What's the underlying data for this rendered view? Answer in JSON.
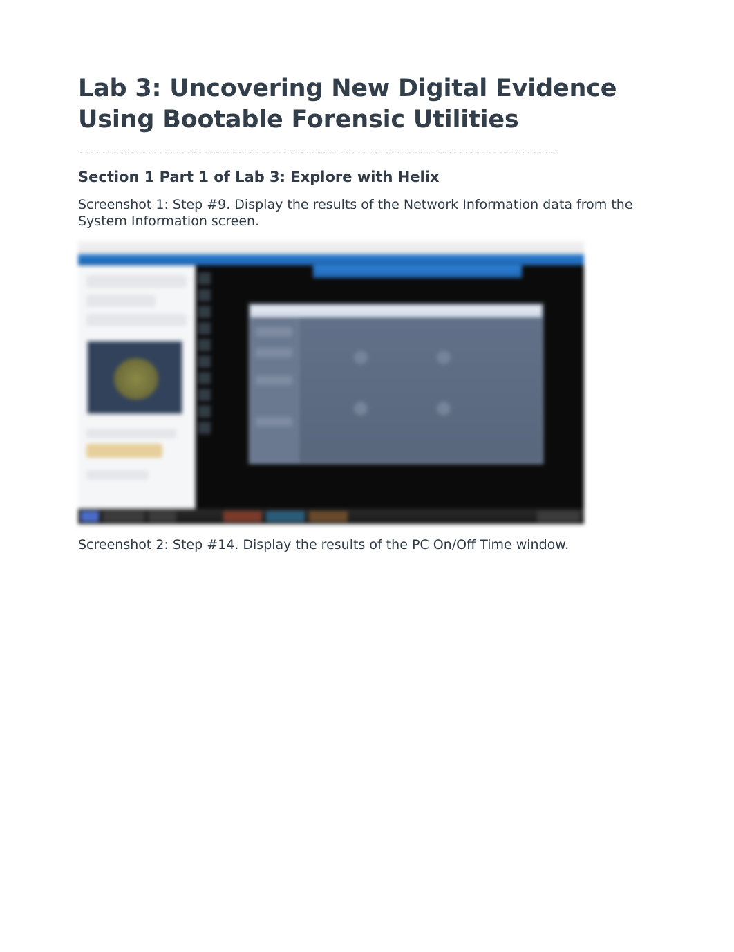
{
  "title": "Lab 3: Uncovering New Digital Evidence Using Bootable Forensic Utilities",
  "divider": "-------------------------------------------------------------------------------------",
  "section_heading": "Section 1 Part 1 of Lab 3: Explore with Helix",
  "caption1": "Screenshot 1: Step #9. Display the results of the Network Information data from the System Information screen.",
  "caption2": "Screenshot 2: Step #14. Display the results of the PC On/Off Time window."
}
